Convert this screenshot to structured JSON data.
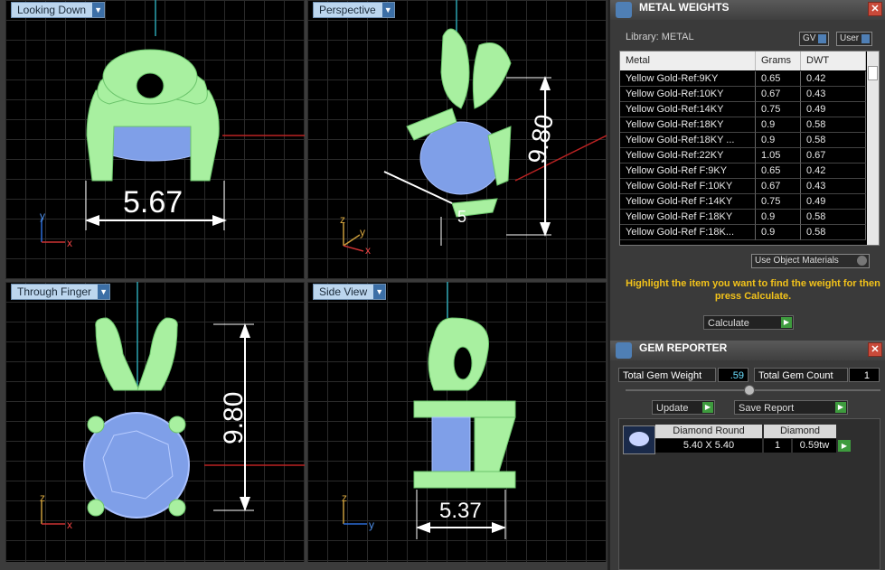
{
  "viewports": {
    "top_left": {
      "label": "Looking Down",
      "dimension": "5.67",
      "axis_v": "y",
      "axis_h": "x"
    },
    "top_right": {
      "label": "Perspective",
      "dimension": "9.80",
      "dimension2": "5",
      "axis_v": "z",
      "axis_h1": "y",
      "axis_h2": "x"
    },
    "bottom_left": {
      "label": "Through Finger",
      "dimension": "9.80",
      "axis_v": "z",
      "axis_h": "x"
    },
    "bottom_right": {
      "label": "Side View",
      "dimension": "5.37",
      "axis_v": "z",
      "axis_h": "y"
    }
  },
  "metal_weights": {
    "title": "METAL WEIGHTS",
    "library_label": "Library: METAL",
    "gv_label": "GV",
    "user_label": "User",
    "columns": [
      "Metal",
      "Grams",
      "DWT"
    ],
    "rows": [
      [
        "Yellow Gold-Ref:9KY",
        "0.65",
        "0.42"
      ],
      [
        "Yellow Gold-Ref:10KY",
        "0.67",
        "0.43"
      ],
      [
        "Yellow Gold-Ref:14KY",
        "0.75",
        "0.49"
      ],
      [
        "Yellow Gold-Ref:18KY",
        "0.9",
        "0.58"
      ],
      [
        "Yellow Gold-Ref:18KY ...",
        "0.9",
        "0.58"
      ],
      [
        "Yellow Gold-Ref:22KY",
        "1.05",
        "0.67"
      ],
      [
        "Yellow Gold-Ref F:9KY",
        "0.65",
        "0.42"
      ],
      [
        "Yellow Gold-Ref F:10KY",
        "0.67",
        "0.43"
      ],
      [
        "Yellow Gold-Ref F:14KY",
        "0.75",
        "0.49"
      ],
      [
        "Yellow Gold-Ref F:18KY",
        "0.9",
        "0.58"
      ],
      [
        "Yellow Gold-Ref F:18K...",
        "0.9",
        "0.58"
      ]
    ],
    "use_object_materials": "Use Object Materials",
    "hint": "Highlight the item you want to find the weight for then press Calculate.",
    "calculate": "Calculate"
  },
  "gem_reporter": {
    "title": "GEM REPORTER",
    "total_weight_label": "Total Gem Weight",
    "total_weight_value": ".59",
    "total_count_label": "Total Gem Count",
    "total_count_value": "1",
    "update": "Update",
    "save_report": "Save Report",
    "gem": {
      "shape": "Diamond Round",
      "type": "Diamond",
      "size": "5.40 X 5.40",
      "count": "1",
      "weight": "0.59tw"
    }
  },
  "colors": {
    "metal": "#a8f0a0",
    "gem": "#7f9fe8",
    "dim_line": "#ffffff",
    "accent": "#f2c21a"
  }
}
